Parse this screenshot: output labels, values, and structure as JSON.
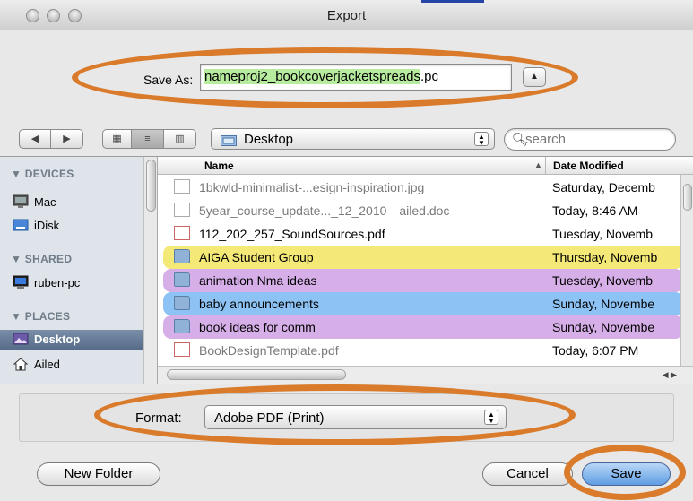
{
  "window": {
    "title": "Export"
  },
  "save_as": {
    "label": "Save As:",
    "value_prefix": "",
    "value_selected": "nameproj2_bookcoverjacketspreads",
    "value_suffix": ".pc"
  },
  "toolbar": {
    "location": "Desktop",
    "search_placeholder": "search"
  },
  "sidebar": {
    "devices_heading": "▼ DEVICES",
    "shared_heading": "▼ SHARED",
    "places_heading": "▼ PLACES",
    "items": [
      {
        "label": "Mac"
      },
      {
        "label": "iDisk"
      },
      {
        "label": "ruben-pc"
      },
      {
        "label": "Desktop"
      },
      {
        "label": "Ailed"
      }
    ]
  },
  "filelist": {
    "col_name": "Name",
    "col_date": "Date Modified",
    "rows": [
      {
        "name": "1bkwld-minimalist-...esign-inspiration.jpg",
        "date": "Saturday, Decemb"
      },
      {
        "name": "5year_course_update..._12_2010—ailed.doc",
        "date": "Today, 8:46 AM"
      },
      {
        "name": "112_202_257_SoundSources.pdf",
        "date": "Tuesday, Novemb"
      },
      {
        "name": "AIGA Student Group",
        "date": "Thursday, Novemb"
      },
      {
        "name": "animation Nma ideas",
        "date": "Tuesday, Novemb"
      },
      {
        "name": "baby announcements",
        "date": "Sunday, Novembe"
      },
      {
        "name": "book ideas for comm",
        "date": "Sunday, Novembe"
      },
      {
        "name": "BookDesignTemplate.pdf",
        "date": "Today, 6:07 PM"
      }
    ]
  },
  "format": {
    "label": "Format:",
    "value": "Adobe PDF (Print)"
  },
  "buttons": {
    "new_folder": "New Folder",
    "cancel": "Cancel",
    "save": "Save"
  },
  "colors": {
    "annotation": "#d97b2a",
    "selection_green": "#b7eb9e",
    "label_yellow": "#f4e876",
    "label_purple": "#d6aee8",
    "label_blue": "#8dc3f4"
  }
}
